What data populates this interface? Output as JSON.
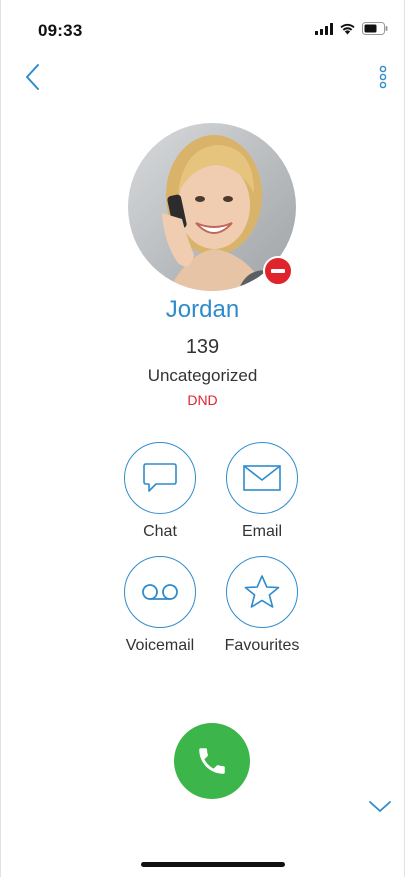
{
  "status_bar": {
    "time": "09:33",
    "icons": [
      "signal-icon",
      "wifi-icon",
      "battery-icon"
    ]
  },
  "nav": {
    "back_icon": "chevron-left-icon",
    "more_icon": "more-vertical-icon"
  },
  "contact": {
    "name": "Jordan",
    "extension": "139",
    "category": "Uncategorized",
    "status": "DND",
    "presence_icon": "do-not-disturb-icon"
  },
  "actions": [
    {
      "label": "Chat",
      "icon": "chat-bubble-icon"
    },
    {
      "label": "Email",
      "icon": "envelope-icon"
    },
    {
      "label": "Voicemail",
      "icon": "voicemail-icon"
    },
    {
      "label": "Favourites",
      "icon": "star-icon"
    }
  ],
  "call": {
    "icon": "phone-icon"
  },
  "expand_icon": "chevron-down-icon",
  "colors": {
    "accent": "#2f8ccc",
    "dnd": "#e0242b",
    "call": "#3cb54a",
    "text": "#333333"
  }
}
